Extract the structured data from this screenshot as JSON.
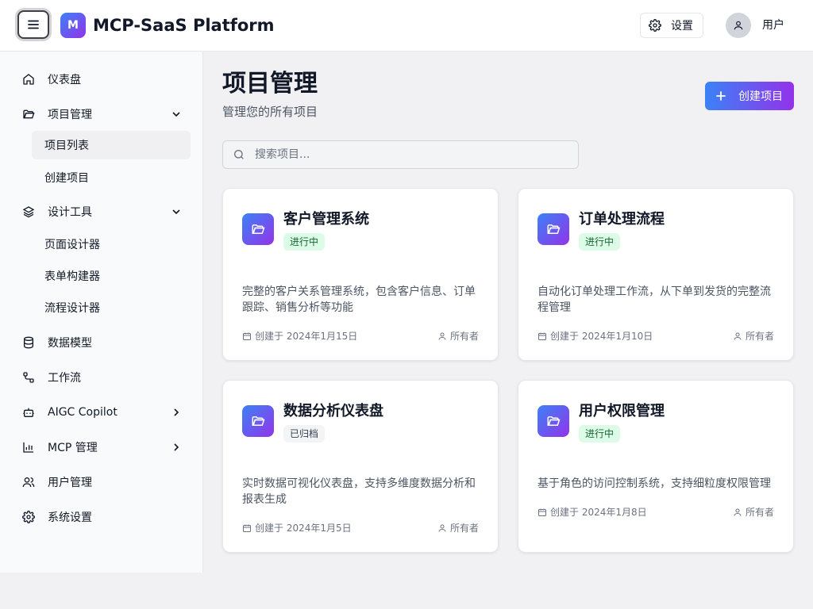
{
  "header": {
    "logo_letter": "M",
    "title": "MCP-SaaS Platform",
    "settings_label": "设置",
    "user_label": "用户"
  },
  "sidebar": {
    "items": [
      {
        "label": "仪表盘",
        "icon": "home-icon"
      },
      {
        "label": "项目管理",
        "icon": "folder-open-icon",
        "expanded": true,
        "children": [
          {
            "label": "项目列表",
            "active": true
          },
          {
            "label": "创建项目"
          }
        ]
      },
      {
        "label": "设计工具",
        "icon": "layers-icon",
        "expanded": true,
        "children": [
          {
            "label": "页面设计器"
          },
          {
            "label": "表单构建器"
          },
          {
            "label": "流程设计器"
          }
        ]
      },
      {
        "label": "数据模型",
        "icon": "database-icon"
      },
      {
        "label": "工作流",
        "icon": "workflow-icon"
      },
      {
        "label": "AIGC Copilot",
        "icon": "bot-icon",
        "expanded": false
      },
      {
        "label": "MCP 管理",
        "icon": "bar-chart-icon",
        "expanded": false
      },
      {
        "label": "用户管理",
        "icon": "users-icon"
      },
      {
        "label": "系统设置",
        "icon": "gear-icon"
      }
    ]
  },
  "main": {
    "title": "项目管理",
    "subtitle": "管理您的所有项目",
    "create_label": "创建项目",
    "search_placeholder": "搜索项目...",
    "projects": [
      {
        "title": "客户管理系统",
        "status": "进行中",
        "status_type": "active",
        "description": "完整的客户关系管理系统，包含客户信息、订单跟踪、销售分析等功能",
        "date": "创建于 2024年1月15日",
        "owner": "所有者"
      },
      {
        "title": "订单处理流程",
        "status": "进行中",
        "status_type": "active",
        "description": "自动化订单处理工作流，从下单到发货的完整流程管理",
        "date": "创建于 2024年1月10日",
        "owner": "所有者"
      },
      {
        "title": "数据分析仪表盘",
        "status": "已归档",
        "status_type": "archived",
        "description": "实时数据可视化仪表盘，支持多维度数据分析和报表生成",
        "date": "创建于 2024年1月5日",
        "owner": "所有者"
      },
      {
        "title": "用户权限管理",
        "status": "进行中",
        "status_type": "active",
        "description": "基于角色的访问控制系统，支持细粒度权限管理",
        "date": "创建于 2024年1月8日",
        "owner": "所有者"
      }
    ]
  },
  "colors": {
    "accent_start": "#3b82f6",
    "accent_end": "#9333ea",
    "active_badge_bg": "#dcfce7",
    "active_badge_text": "#166534",
    "archived_badge_bg": "#f3f4f6"
  }
}
